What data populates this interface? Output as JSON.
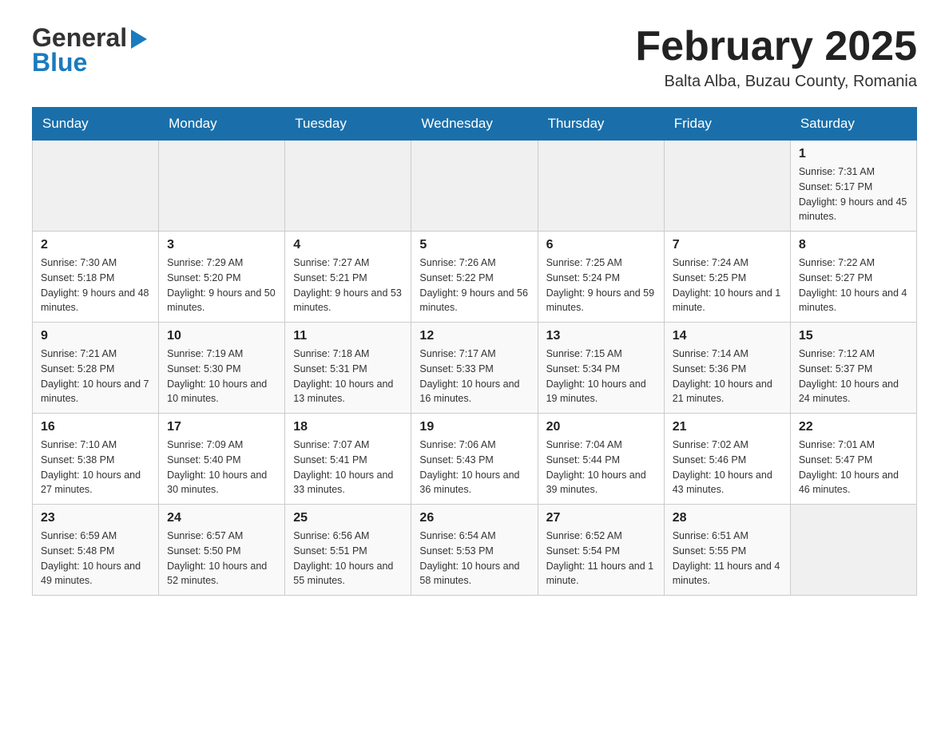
{
  "header": {
    "logo": {
      "general": "General",
      "blue": "Blue",
      "arrow": "▶"
    },
    "title": "February 2025",
    "location": "Balta Alba, Buzau County, Romania"
  },
  "weekdays": [
    "Sunday",
    "Monday",
    "Tuesday",
    "Wednesday",
    "Thursday",
    "Friday",
    "Saturday"
  ],
  "weeks": [
    [
      {
        "day": "",
        "info": ""
      },
      {
        "day": "",
        "info": ""
      },
      {
        "day": "",
        "info": ""
      },
      {
        "day": "",
        "info": ""
      },
      {
        "day": "",
        "info": ""
      },
      {
        "day": "",
        "info": ""
      },
      {
        "day": "1",
        "info": "Sunrise: 7:31 AM\nSunset: 5:17 PM\nDaylight: 9 hours and 45 minutes."
      }
    ],
    [
      {
        "day": "2",
        "info": "Sunrise: 7:30 AM\nSunset: 5:18 PM\nDaylight: 9 hours and 48 minutes."
      },
      {
        "day": "3",
        "info": "Sunrise: 7:29 AM\nSunset: 5:20 PM\nDaylight: 9 hours and 50 minutes."
      },
      {
        "day": "4",
        "info": "Sunrise: 7:27 AM\nSunset: 5:21 PM\nDaylight: 9 hours and 53 minutes."
      },
      {
        "day": "5",
        "info": "Sunrise: 7:26 AM\nSunset: 5:22 PM\nDaylight: 9 hours and 56 minutes."
      },
      {
        "day": "6",
        "info": "Sunrise: 7:25 AM\nSunset: 5:24 PM\nDaylight: 9 hours and 59 minutes."
      },
      {
        "day": "7",
        "info": "Sunrise: 7:24 AM\nSunset: 5:25 PM\nDaylight: 10 hours and 1 minute."
      },
      {
        "day": "8",
        "info": "Sunrise: 7:22 AM\nSunset: 5:27 PM\nDaylight: 10 hours and 4 minutes."
      }
    ],
    [
      {
        "day": "9",
        "info": "Sunrise: 7:21 AM\nSunset: 5:28 PM\nDaylight: 10 hours and 7 minutes."
      },
      {
        "day": "10",
        "info": "Sunrise: 7:19 AM\nSunset: 5:30 PM\nDaylight: 10 hours and 10 minutes."
      },
      {
        "day": "11",
        "info": "Sunrise: 7:18 AM\nSunset: 5:31 PM\nDaylight: 10 hours and 13 minutes."
      },
      {
        "day": "12",
        "info": "Sunrise: 7:17 AM\nSunset: 5:33 PM\nDaylight: 10 hours and 16 minutes."
      },
      {
        "day": "13",
        "info": "Sunrise: 7:15 AM\nSunset: 5:34 PM\nDaylight: 10 hours and 19 minutes."
      },
      {
        "day": "14",
        "info": "Sunrise: 7:14 AM\nSunset: 5:36 PM\nDaylight: 10 hours and 21 minutes."
      },
      {
        "day": "15",
        "info": "Sunrise: 7:12 AM\nSunset: 5:37 PM\nDaylight: 10 hours and 24 minutes."
      }
    ],
    [
      {
        "day": "16",
        "info": "Sunrise: 7:10 AM\nSunset: 5:38 PM\nDaylight: 10 hours and 27 minutes."
      },
      {
        "day": "17",
        "info": "Sunrise: 7:09 AM\nSunset: 5:40 PM\nDaylight: 10 hours and 30 minutes."
      },
      {
        "day": "18",
        "info": "Sunrise: 7:07 AM\nSunset: 5:41 PM\nDaylight: 10 hours and 33 minutes."
      },
      {
        "day": "19",
        "info": "Sunrise: 7:06 AM\nSunset: 5:43 PM\nDaylight: 10 hours and 36 minutes."
      },
      {
        "day": "20",
        "info": "Sunrise: 7:04 AM\nSunset: 5:44 PM\nDaylight: 10 hours and 39 minutes."
      },
      {
        "day": "21",
        "info": "Sunrise: 7:02 AM\nSunset: 5:46 PM\nDaylight: 10 hours and 43 minutes."
      },
      {
        "day": "22",
        "info": "Sunrise: 7:01 AM\nSunset: 5:47 PM\nDaylight: 10 hours and 46 minutes."
      }
    ],
    [
      {
        "day": "23",
        "info": "Sunrise: 6:59 AM\nSunset: 5:48 PM\nDaylight: 10 hours and 49 minutes."
      },
      {
        "day": "24",
        "info": "Sunrise: 6:57 AM\nSunset: 5:50 PM\nDaylight: 10 hours and 52 minutes."
      },
      {
        "day": "25",
        "info": "Sunrise: 6:56 AM\nSunset: 5:51 PM\nDaylight: 10 hours and 55 minutes."
      },
      {
        "day": "26",
        "info": "Sunrise: 6:54 AM\nSunset: 5:53 PM\nDaylight: 10 hours and 58 minutes."
      },
      {
        "day": "27",
        "info": "Sunrise: 6:52 AM\nSunset: 5:54 PM\nDaylight: 11 hours and 1 minute."
      },
      {
        "day": "28",
        "info": "Sunrise: 6:51 AM\nSunset: 5:55 PM\nDaylight: 11 hours and 4 minutes."
      },
      {
        "day": "",
        "info": ""
      }
    ]
  ]
}
